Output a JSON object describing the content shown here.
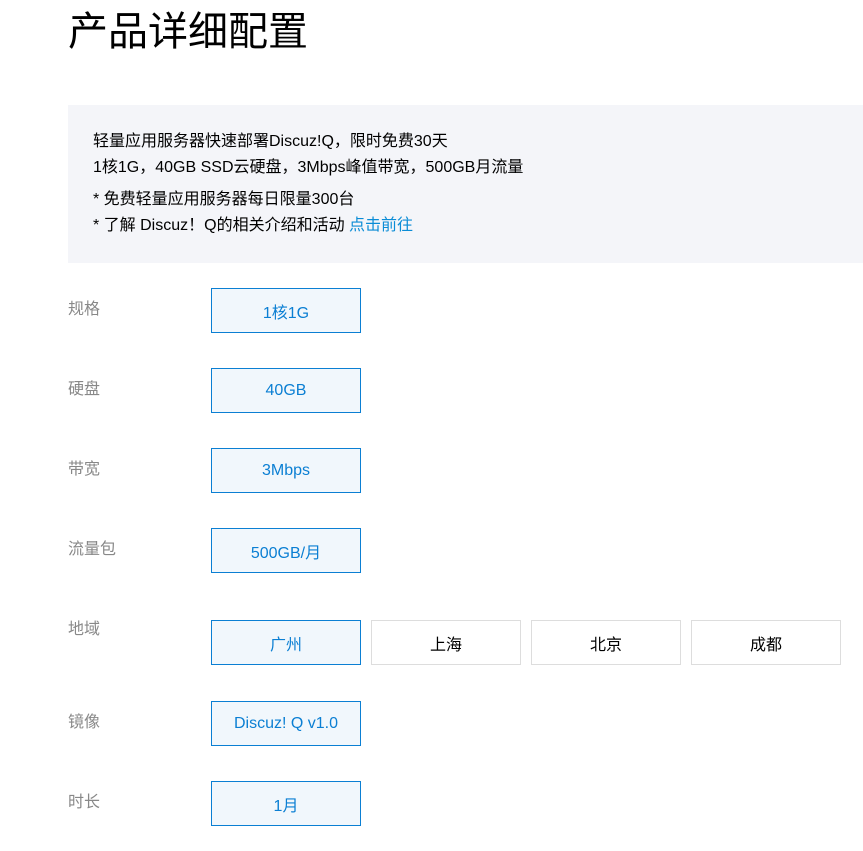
{
  "page": {
    "title": "产品详细配置"
  },
  "info": {
    "line1": "轻量应用服务器快速部署Discuz!Q，限时免费30天",
    "line2": "1核1G，40GB SSD云硬盘，3Mbps峰值带宽，500GB月流量",
    "note1": "* 免费轻量应用服务器每日限量300台",
    "note2_prefix": "* 了解 Discuz！Q的相关介绍和活动 ",
    "note2_link": "点击前往"
  },
  "config": {
    "spec": {
      "label": "规格",
      "options": [
        "1核1G"
      ],
      "selected": "1核1G"
    },
    "disk": {
      "label": "硬盘",
      "options": [
        "40GB"
      ],
      "selected": "40GB"
    },
    "bandwidth": {
      "label": "带宽",
      "options": [
        "3Mbps"
      ],
      "selected": "3Mbps"
    },
    "traffic": {
      "label": "流量包",
      "options": [
        "500GB/月"
      ],
      "selected": "500GB/月"
    },
    "region": {
      "label": "地域",
      "options": [
        "广州",
        "上海",
        "北京",
        "成都"
      ],
      "selected": "广州"
    },
    "image": {
      "label": "镜像",
      "options": [
        "Discuz! Q v1.0"
      ],
      "selected": "Discuz! Q v1.0"
    },
    "duration": {
      "label": "时长",
      "options": [
        "1月"
      ],
      "selected": "1月"
    }
  },
  "colors": {
    "accent": "#0b7fd3",
    "link": "#0a8cd6",
    "info_bg": "#f4f5f9",
    "label_gray": "#888888"
  }
}
